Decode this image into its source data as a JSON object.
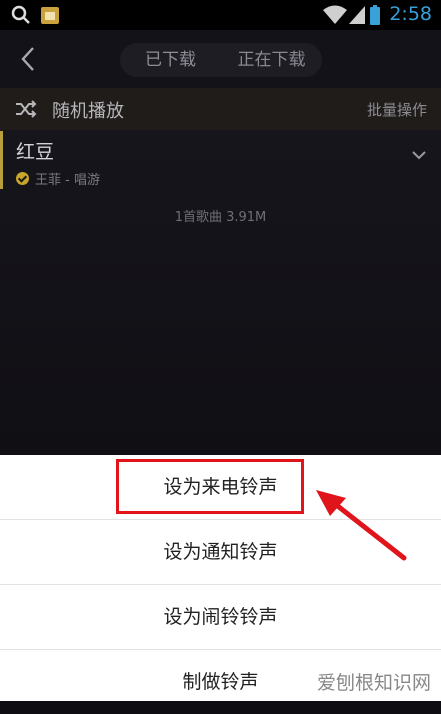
{
  "status_bar": {
    "time": "2:58"
  },
  "header": {
    "tabs": [
      {
        "label": "已下载"
      },
      {
        "label": "正在下载"
      }
    ]
  },
  "list": {
    "shuffle_label": "随机播放",
    "batch_label": "批量操作",
    "songs": [
      {
        "title": "红豆",
        "subtitle": "王菲 - 唱游"
      }
    ],
    "summary": "1首歌曲 3.91M"
  },
  "menu": {
    "items": [
      {
        "label": "设为来电铃声"
      },
      {
        "label": "设为通知铃声"
      },
      {
        "label": "设为闹铃铃声"
      },
      {
        "label": "制做铃声"
      }
    ]
  },
  "watermark": "爱刨根知识网",
  "colors": {
    "highlight": "#e0141b",
    "accent": "#3aa0d8",
    "gold": "#c9a62b"
  }
}
